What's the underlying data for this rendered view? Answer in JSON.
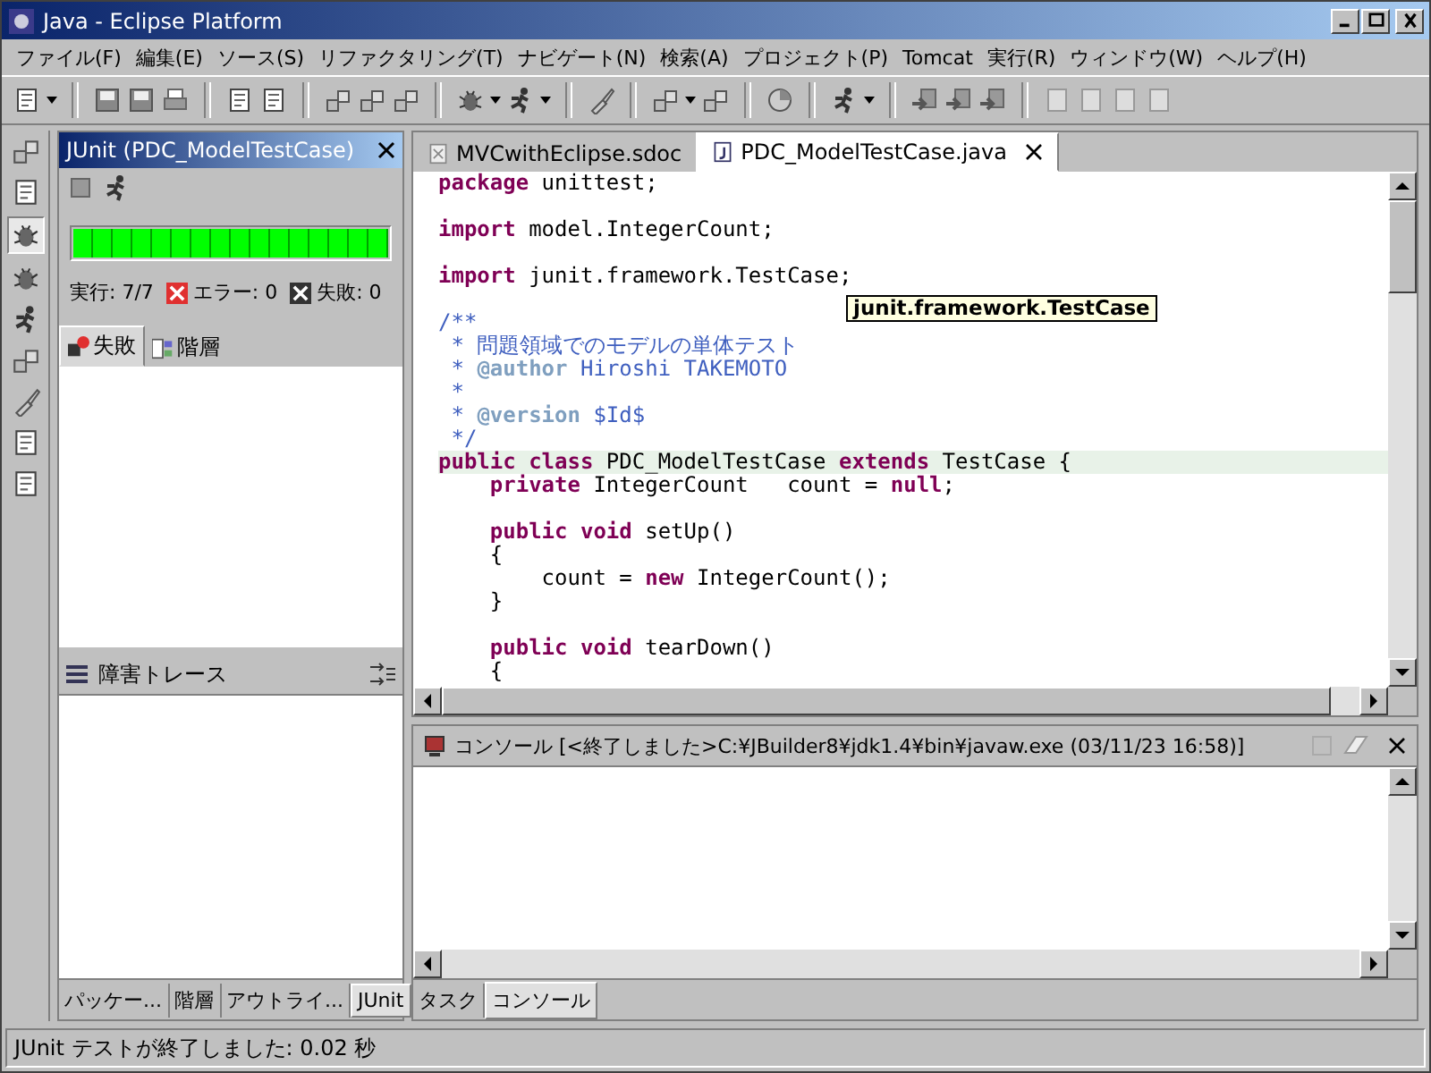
{
  "window": {
    "title": "Java - Eclipse Platform"
  },
  "menu": [
    "ファイル(F)",
    "編集(E)",
    "ソース(S)",
    "リファクタリング(T)",
    "ナビゲート(N)",
    "検索(A)",
    "プロジェクト(P)",
    "Tomcat",
    "実行(R)",
    "ウィンドウ(W)",
    "ヘルプ(H)"
  ],
  "junit_view": {
    "title": "JUnit (PDC_ModelTestCase)",
    "active": true,
    "level": 1,
    "counts": [
      {
        "kind": "runs",
        "label": "実行: 7/7"
      },
      {
        "kind": "errors",
        "label": "エラー: 0"
      },
      {
        "kind": "failures",
        "label": "失敗: 0"
      }
    ],
    "tabs": [
      {
        "kind": "failures",
        "label": "失敗",
        "selected": true
      },
      {
        "kind": "hierarchy",
        "label": "階層",
        "selected": false
      }
    ]
  },
  "trace_view": {
    "title": "障害トレース"
  },
  "left_tabs": [
    {
      "label": "パッケー...",
      "selected": false
    },
    {
      "label": "階層",
      "selected": false
    },
    {
      "label": "アウトライ...",
      "selected": false
    },
    {
      "label": "JUnit",
      "selected": true
    }
  ],
  "editor": {
    "tabs": [
      {
        "kind": "sdoc",
        "label": "MVCwithEclipse.sdoc",
        "selected": false
      },
      {
        "kind": "java",
        "label": "PDC_ModelTestCase.java",
        "selected": true
      }
    ],
    "tooltip": "junit.framework.TestCase",
    "lines": [
      {
        "kind": "code",
        "highlighted": false,
        "tokens": [
          {
            "kind": "keyword",
            "text": "package"
          },
          {
            "kind": "plain",
            "text": " unittest;"
          }
        ]
      },
      {
        "kind": "blank"
      },
      {
        "kind": "code",
        "highlighted": false,
        "tokens": [
          {
            "kind": "keyword",
            "text": "import"
          },
          {
            "kind": "plain",
            "text": " model.IntegerCount;"
          }
        ]
      },
      {
        "kind": "blank"
      },
      {
        "kind": "code",
        "highlighted": false,
        "tokens": [
          {
            "kind": "keyword",
            "text": "import"
          },
          {
            "kind": "plain",
            "text": " junit.framework.TestCase;"
          }
        ]
      },
      {
        "kind": "blank"
      },
      {
        "kind": "code",
        "highlighted": false,
        "tokens": [
          {
            "kind": "comment",
            "text": "/**"
          }
        ]
      },
      {
        "kind": "code",
        "highlighted": false,
        "tokens": [
          {
            "kind": "comment",
            "text": " * 問題領域でのモデルの単体テスト"
          }
        ]
      },
      {
        "kind": "code",
        "highlighted": false,
        "tokens": [
          {
            "kind": "comment",
            "text": " * "
          },
          {
            "kind": "doctag",
            "text": "@author"
          },
          {
            "kind": "comment",
            "text": " Hiroshi TAKEMOTO"
          }
        ]
      },
      {
        "kind": "code",
        "highlighted": false,
        "tokens": [
          {
            "kind": "comment",
            "text": " *"
          }
        ]
      },
      {
        "kind": "code",
        "highlighted": false,
        "tokens": [
          {
            "kind": "comment",
            "text": " * "
          },
          {
            "kind": "doctag",
            "text": "@version"
          },
          {
            "kind": "comment",
            "text": " $Id$"
          }
        ]
      },
      {
        "kind": "code",
        "highlighted": false,
        "tokens": [
          {
            "kind": "comment",
            "text": " */"
          }
        ]
      },
      {
        "kind": "code",
        "highlighted": true,
        "tokens": [
          {
            "kind": "keyword",
            "text": "public class"
          },
          {
            "kind": "plain",
            "text": " PDC_ModelTestCase "
          },
          {
            "kind": "keyword",
            "text": "extends"
          },
          {
            "kind": "plain",
            "text": " TestCase {"
          }
        ]
      },
      {
        "kind": "code",
        "highlighted": false,
        "tokens": [
          {
            "kind": "keyword",
            "text": "    private"
          },
          {
            "kind": "plain",
            "text": " IntegerCount   count = "
          },
          {
            "kind": "keyword",
            "text": "null"
          },
          {
            "kind": "plain",
            "text": ";"
          }
        ]
      },
      {
        "kind": "blank"
      },
      {
        "kind": "code",
        "highlighted": false,
        "tokens": [
          {
            "kind": "keyword",
            "text": "    public void"
          },
          {
            "kind": "plain",
            "text": " setUp()"
          }
        ]
      },
      {
        "kind": "code",
        "highlighted": false,
        "tokens": [
          {
            "kind": "plain",
            "text": "    {"
          }
        ]
      },
      {
        "kind": "code",
        "highlighted": false,
        "tokens": [
          {
            "kind": "plain",
            "text": "        count = "
          },
          {
            "kind": "keyword",
            "text": "new"
          },
          {
            "kind": "plain",
            "text": " IntegerCount();"
          }
        ]
      },
      {
        "kind": "code",
        "highlighted": false,
        "tokens": [
          {
            "kind": "plain",
            "text": "    }"
          }
        ]
      },
      {
        "kind": "blank"
      },
      {
        "kind": "code",
        "highlighted": false,
        "tokens": [
          {
            "kind": "keyword",
            "text": "    public void"
          },
          {
            "kind": "plain",
            "text": " tearDown()"
          }
        ]
      },
      {
        "kind": "code",
        "highlighted": false,
        "tokens": [
          {
            "kind": "plain",
            "text": "    {"
          }
        ]
      }
    ]
  },
  "console": {
    "title": "コンソール [<終了しました>C:¥JBuilder8¥jdk1.4¥bin¥javaw.exe (03/11/23 16:58)]",
    "tabs": [
      {
        "label": "タスク",
        "selected": false
      },
      {
        "label": "コンソール",
        "selected": true
      }
    ]
  },
  "status_bar": "JUnit テストが終了しました: 0.02 秒"
}
